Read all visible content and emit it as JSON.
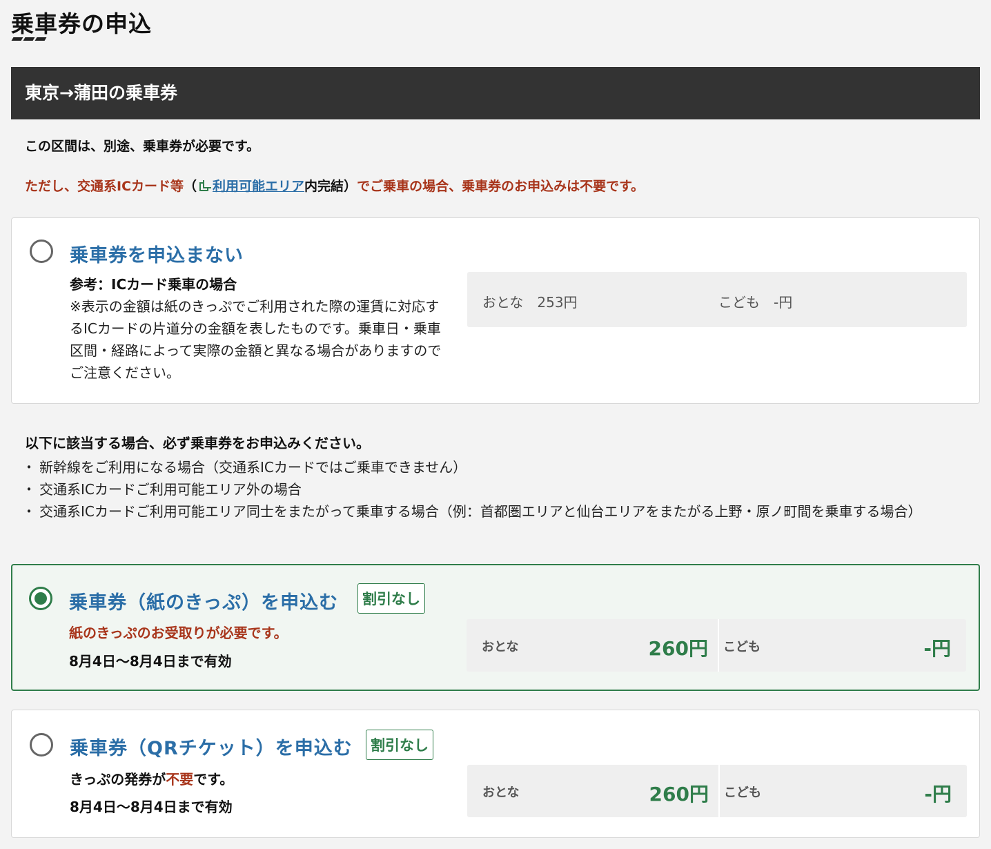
{
  "page_title": "乗車券の申込",
  "section_title": "東京→蒲田の乗車券",
  "notice": {
    "black": "この区間は、別途、乗車券が必要です。",
    "red_prefix": "ただし、交通系ICカード等",
    "paren_open": "（",
    "link_text": "利用可能エリア",
    "dark_after_link": "内完結",
    "paren_close": "）",
    "red_suffix": "でご乗車の場合、乗車券のお申込みは不要です。"
  },
  "option_none": {
    "title": "乗車券を申込まない",
    "ref_title": "参考：ICカード乗車の場合",
    "ref_body": "※表示の金額は紙のきっぷでご利用された際の運賃に対応するICカードの片道分の金額を表したものです。乗車日・乗車区間・経路によって実際の金額と異なる場合がありますのでご注意ください。",
    "adult_text": "おとな　253円",
    "child_text": "こども　-円",
    "selected": false
  },
  "requirement": {
    "title": "以下に該当する場合、必ず乗車券をお申込みください。",
    "items": [
      "新幹線をご利用になる場合（交通系ICカードではご乗車できません）",
      "交通系ICカードご利用可能エリア外の場合",
      "交通系ICカードご利用可能エリア同士をまたがって乗車する場合（例：首都圏エリアと仙台エリアをまたがる上野・原ノ町間を乗車する場合）"
    ]
  },
  "option_paper": {
    "title": "乗車券（紙のきっぷ）を申込む",
    "badge": "割引なし",
    "note": "紙のきっぷのお受取りが必要です。",
    "validity": "8月4日〜8月4日まで有効",
    "adult_label": "おとな",
    "adult_price": "260円",
    "child_label": "こども",
    "child_price": "-円",
    "selected": true
  },
  "option_qr": {
    "title": "乗車券（QRチケット）を申込む",
    "badge": "割引なし",
    "note_prefix": "きっぷの発券が",
    "note_red": "不要",
    "note_suffix": "です。",
    "validity": "8月4日〜8月4日まで有効",
    "adult_label": "おとな",
    "adult_price": "260円",
    "child_label": "こども",
    "child_price": "-円",
    "selected": false
  },
  "colors": {
    "header_bg": "#333333",
    "accent_green": "#2f7d4a",
    "title_blue": "#2b6ea7",
    "warning_red": "#a8351b"
  }
}
